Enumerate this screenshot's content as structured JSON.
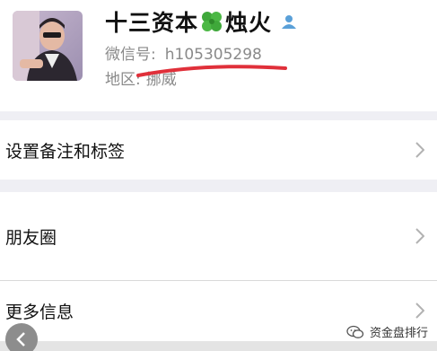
{
  "profile": {
    "name_part1": "十三资本",
    "name_part2": "烛火",
    "wechat_label": "微信号:",
    "wechat_id": "h105305298",
    "region_label": "地区:",
    "region_value": "挪威"
  },
  "menu": {
    "tags_label": "设置备注和标签",
    "moments_label": "朋友圈",
    "more_info_label": "更多信息"
  },
  "watermark": {
    "text": "资金盘排行"
  },
  "icons": {
    "clover": "four-leaf-clover-icon",
    "person": "person-icon",
    "chevron": "chevron-right-icon",
    "back": "back-arrow-icon",
    "watermark": "wechat-official-account-icon"
  },
  "colors": {
    "clover_green": "#3fa83a",
    "person_blue": "#5aa0d8",
    "red_scribble": "#e0303a",
    "chevron_gray": "#b2b2b2"
  }
}
